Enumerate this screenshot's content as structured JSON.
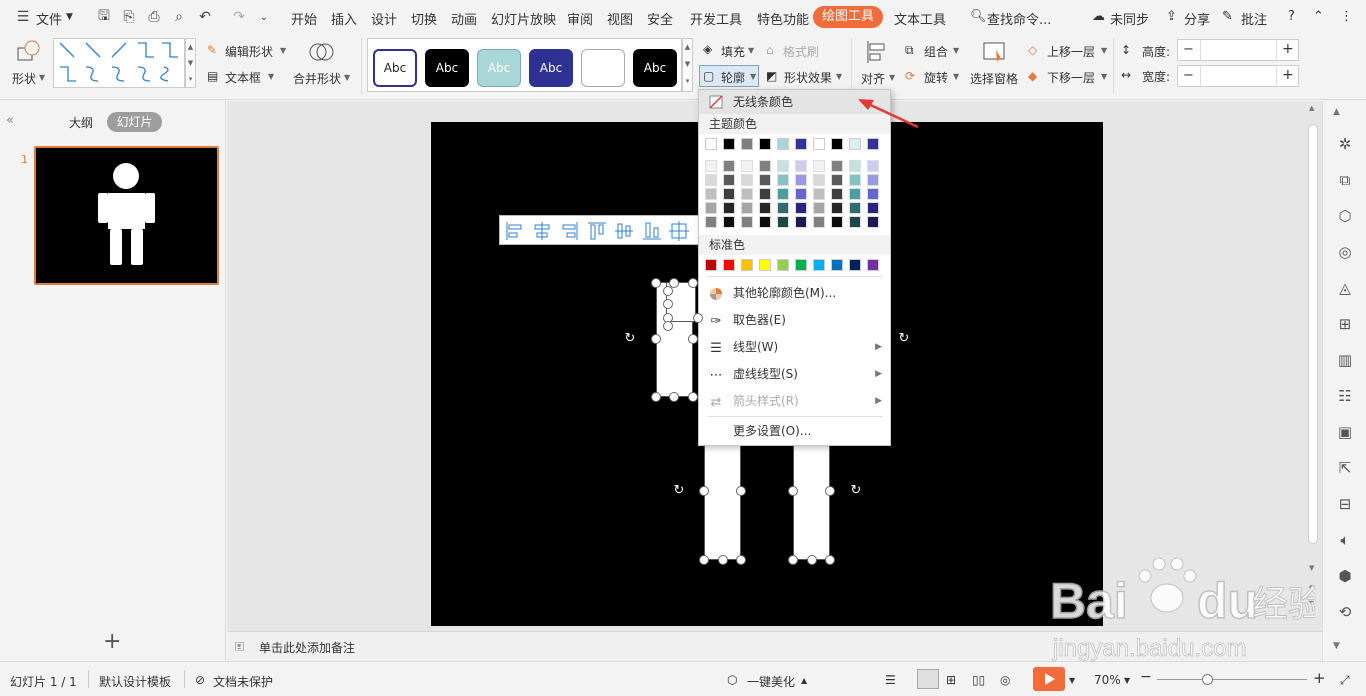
{
  "menu": {
    "file": "文件",
    "tabs": [
      "开始",
      "插入",
      "设计",
      "切换",
      "动画",
      "幻灯片放映",
      "审阅",
      "视图",
      "安全",
      "开发工具",
      "特色功能"
    ],
    "active_tab": "绘图工具",
    "text_tool": "文本工具",
    "search": "查找命令...",
    "sync": "未同步",
    "share": "分享",
    "comment": "批注",
    "help": "?"
  },
  "ribbon": {
    "shape": "形状",
    "edit_shape": "编辑形状",
    "text_box": "文本框",
    "merge_shape": "合并形状",
    "abc": [
      "Abc",
      "Abc",
      "Abc",
      "Abc",
      "",
      "Abc"
    ],
    "fill": "填充",
    "format_painter": "格式刷",
    "outline": "轮廓",
    "shape_effect": "形状效果",
    "align": "对齐",
    "group": "组合",
    "rotate": "旋转",
    "selection_pane": "选择窗格",
    "bring_forward": "上移一层",
    "send_backward": "下移一层",
    "height": "高度:",
    "width": "宽度:",
    "minus": "−",
    "plus": "+"
  },
  "left": {
    "outline_tab": "大纲",
    "slides_tab": "幻灯片",
    "slide_number": "1",
    "add": "+"
  },
  "notes": {
    "placeholder": "单击此处添加备注"
  },
  "dropdown": {
    "no_line": "无线条颜色",
    "theme_colors": "主题颜色",
    "standard_colors": "标准色",
    "more_colors": "其他轮廓颜色(M)...",
    "eyedropper": "取色器(E)",
    "line_type": "线型(W)",
    "dash_type": "虚线线型(S)",
    "arrow_style": "箭头样式(R)",
    "more_settings": "更多设置(O)...",
    "theme_top": [
      "#ffffff",
      "#000000",
      "#7f7f7f",
      "#000000",
      "#a9d6d6",
      "#333399",
      "#ffffff",
      "#000000",
      "#dbeef3",
      "#333399"
    ],
    "theme_shades": [
      [
        "#f2f2f2",
        "#7f7f7f",
        "#f2f2f2",
        "#7f7f7f",
        "#c5e0e0",
        "#ccccf0",
        "#f2f2f2",
        "#7f7f7f",
        "#c5e0e0",
        "#ccccf0"
      ],
      [
        "#d9d9d9",
        "#595959",
        "#d9d9d9",
        "#595959",
        "#86c2c2",
        "#9999e0",
        "#d9d9d9",
        "#595959",
        "#86c2c2",
        "#9999e0"
      ],
      [
        "#bfbfbf",
        "#3f3f3f",
        "#bfbfbf",
        "#3f3f3f",
        "#4aa0a0",
        "#6666d0",
        "#bfbfbf",
        "#3f3f3f",
        "#4aa0a0",
        "#6666d0"
      ],
      [
        "#a5a5a5",
        "#262626",
        "#a5a5a5",
        "#262626",
        "#2f6b6b",
        "#262680",
        "#a5a5a5",
        "#262626",
        "#2f6b6b",
        "#262680"
      ],
      [
        "#7f7f7f",
        "#0d0d0d",
        "#7f7f7f",
        "#0d0d0d",
        "#1f4747",
        "#1a1a55",
        "#7f7f7f",
        "#0d0d0d",
        "#1f4747",
        "#1a1a55"
      ]
    ],
    "standard": [
      "#c00000",
      "#ff0000",
      "#ffc000",
      "#ffff00",
      "#92d050",
      "#00b050",
      "#00b0f0",
      "#0070c0",
      "#002060",
      "#7030a0"
    ]
  },
  "status": {
    "slide_info": "幻灯片 1 / 1",
    "template": "默认设计模板",
    "protect": "文档未保护",
    "beautify": "一键美化",
    "zoom": "70%",
    "zoom_minus": "−",
    "zoom_plus": "+"
  },
  "watermark": {
    "brand": "Bai",
    "brand2": "du",
    "jingyan": "经验",
    "url": "jingyan.baidu.com"
  },
  "colors": {
    "accent": "#f26b3a",
    "arrow": "#e53935",
    "play": "#f26b3a",
    "selected_abc": "#2e3192"
  }
}
